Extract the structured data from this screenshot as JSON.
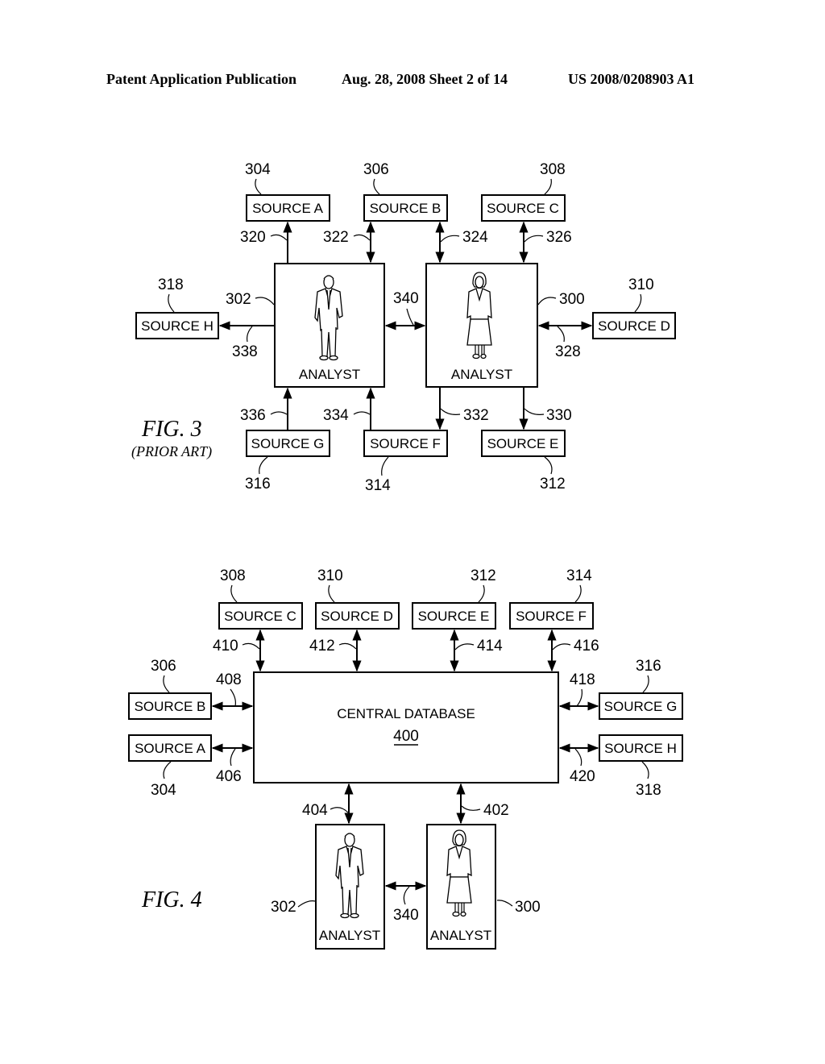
{
  "header": {
    "left": "Patent Application Publication",
    "middle": "Aug. 28, 2008  Sheet 2 of 14",
    "right": "US 2008/0208903 A1"
  },
  "fig3": {
    "title": "FIG. 3",
    "subtitle": "(PRIOR ART)",
    "analysts": [
      {
        "id": "302",
        "label": "ANALYST",
        "figure": "man-icon"
      },
      {
        "id": "300",
        "label": "ANALYST",
        "figure": "woman-icon"
      }
    ],
    "sources": [
      {
        "label": "SOURCE A",
        "ref": "304",
        "link": "320"
      },
      {
        "label": "SOURCE B",
        "ref": "306",
        "link": "322"
      },
      {
        "label": "SOURCE C",
        "ref": "308",
        "link": "326"
      },
      {
        "label": "SOURCE D",
        "ref": "310",
        "link": "328"
      },
      {
        "label": "SOURCE E",
        "ref": "312",
        "link": "330"
      },
      {
        "label": "SOURCE F",
        "ref": "314",
        "link": "332"
      },
      {
        "label": "SOURCE G",
        "ref": "316",
        "link": "336"
      },
      {
        "label": "SOURCE H",
        "ref": "318",
        "link": "338"
      }
    ],
    "extra_links": {
      "analyst_link": "340",
      "b_to_analyst300": "324",
      "f_from_analyst302": "334"
    }
  },
  "fig4": {
    "title": "FIG. 4",
    "database": {
      "label": "CENTRAL DATABASE",
      "ref": "400"
    },
    "sources": [
      {
        "label": "SOURCE A",
        "ref": "304",
        "link": "406"
      },
      {
        "label": "SOURCE B",
        "ref": "306",
        "link": "408"
      },
      {
        "label": "SOURCE C",
        "ref": "308",
        "link": "410"
      },
      {
        "label": "SOURCE D",
        "ref": "310",
        "link": "412"
      },
      {
        "label": "SOURCE E",
        "ref": "312",
        "link": "414"
      },
      {
        "label": "SOURCE F",
        "ref": "314",
        "link": "416"
      },
      {
        "label": "SOURCE G",
        "ref": "316",
        "link": "418"
      },
      {
        "label": "SOURCE H",
        "ref": "318",
        "link": "420"
      }
    ],
    "analysts": [
      {
        "id": "302",
        "label": "ANALYST",
        "link": "404"
      },
      {
        "id": "300",
        "label": "ANALYST",
        "link": "402"
      }
    ],
    "analyst_link": "340"
  }
}
